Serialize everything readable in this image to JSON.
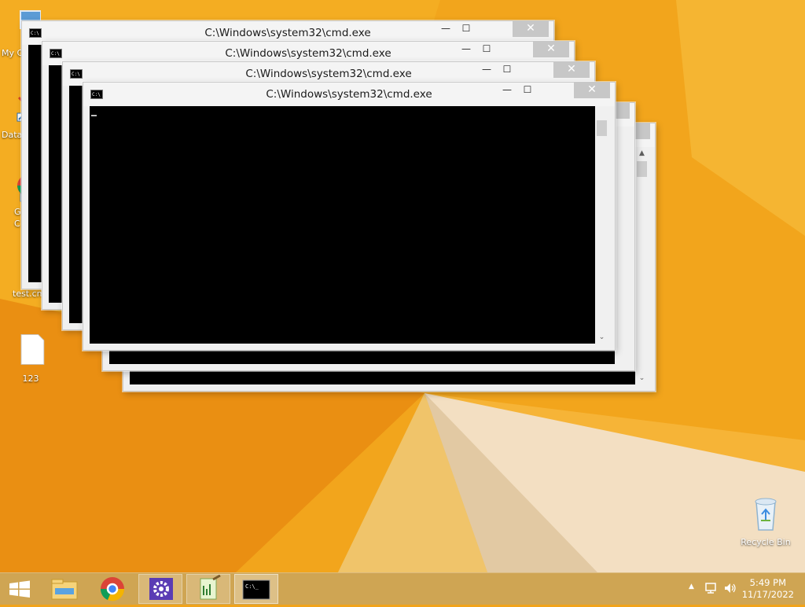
{
  "desktop": {
    "icons": [
      {
        "label": "My C",
        "icon": "computer-icon"
      },
      {
        "label": "Data",
        "icon": "shortcut-icon"
      },
      {
        "label": "G",
        "label2": "C",
        "icon": "chrome-shortcut-icon"
      },
      {
        "label": "test.cm",
        "icon": "batch-file-icon"
      },
      {
        "label": "123",
        "icon": "blank-file-icon"
      },
      {
        "label": "Recycle Bin",
        "icon": "recycle-bin-icon"
      }
    ]
  },
  "windows": [
    {
      "title": "C:\\Windows\\system32\\cmd.exe"
    },
    {
      "title": "C:\\Windows\\system32\\cmd.exe"
    },
    {
      "title": "C:\\Windows\\system32\\cmd.exe"
    },
    {
      "title": "C:\\Windows\\system32\\cmd.exe"
    }
  ],
  "window_controls": {
    "minimize": "—",
    "maximize": "☐",
    "close": "✕"
  },
  "taskbar": {
    "apps": [
      "start-icon",
      "file-explorer-icon",
      "chrome-icon",
      "settings-icon",
      "notepad-plus-icon",
      "command-prompt-icon"
    ],
    "clock": {
      "time": "5:49 PM",
      "date": "11/17/2022"
    }
  },
  "colors": {
    "wallpaper_orange": "#f1a31a",
    "taskbar": "#cfa553",
    "console_bg": "#000000",
    "close_button": "#c7c7c7"
  }
}
